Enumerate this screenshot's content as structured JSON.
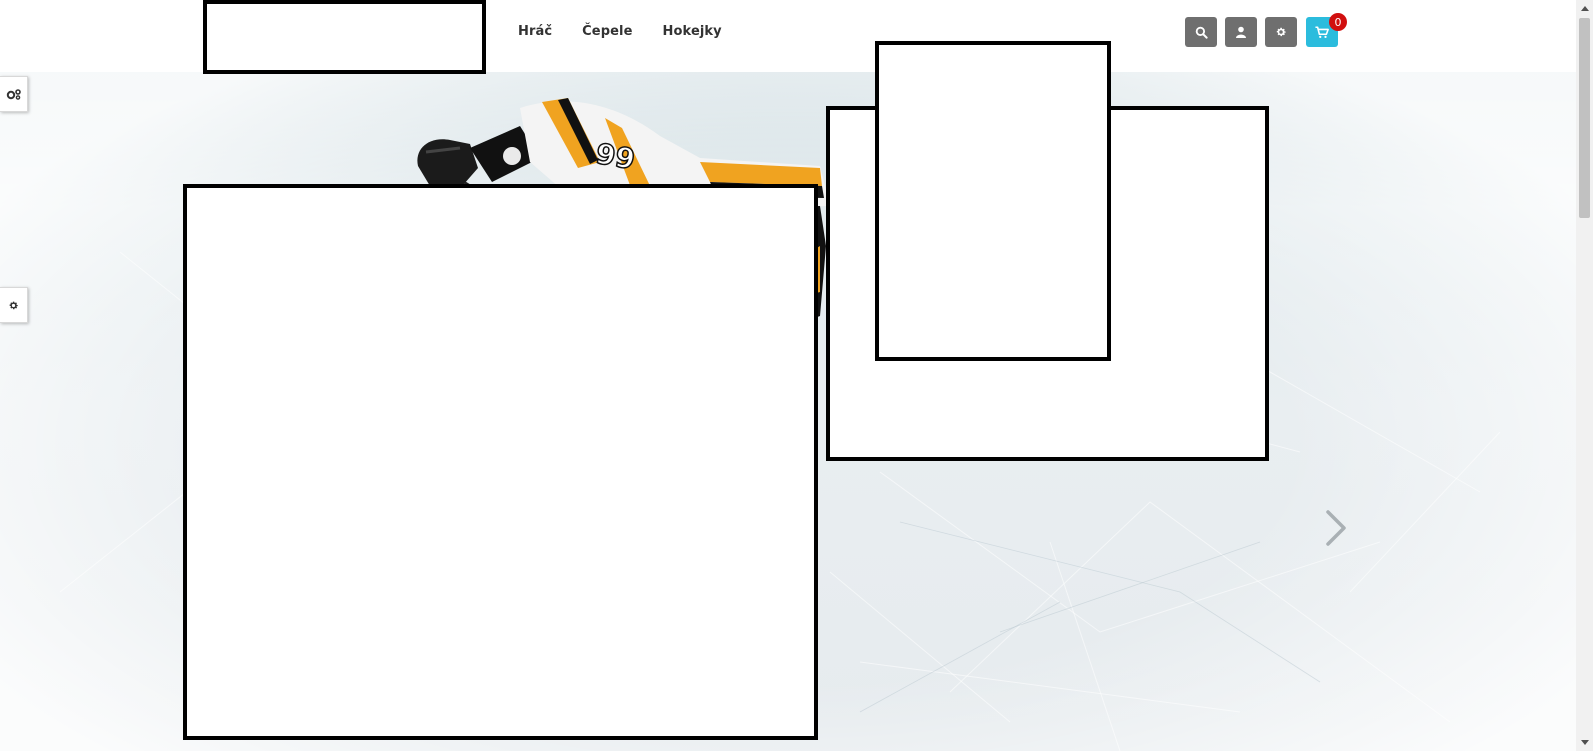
{
  "nav": {
    "items": [
      {
        "label": "Hráč"
      },
      {
        "label": "Čepele"
      },
      {
        "label": "Hokejky"
      }
    ]
  },
  "header": {
    "icons": [
      "search-icon",
      "user-icon",
      "gear-icon",
      "cart-icon"
    ],
    "cart_count": "0",
    "colors": {
      "icon_button": "#6f6f6f",
      "cart_button": "#2bbcdd",
      "badge": "#d10f0f"
    }
  },
  "hero": {
    "player_jersey_number": "99",
    "side_tabs": [
      "settings-icon",
      "gear-icon"
    ],
    "next_control": "chevron-right-icon"
  }
}
